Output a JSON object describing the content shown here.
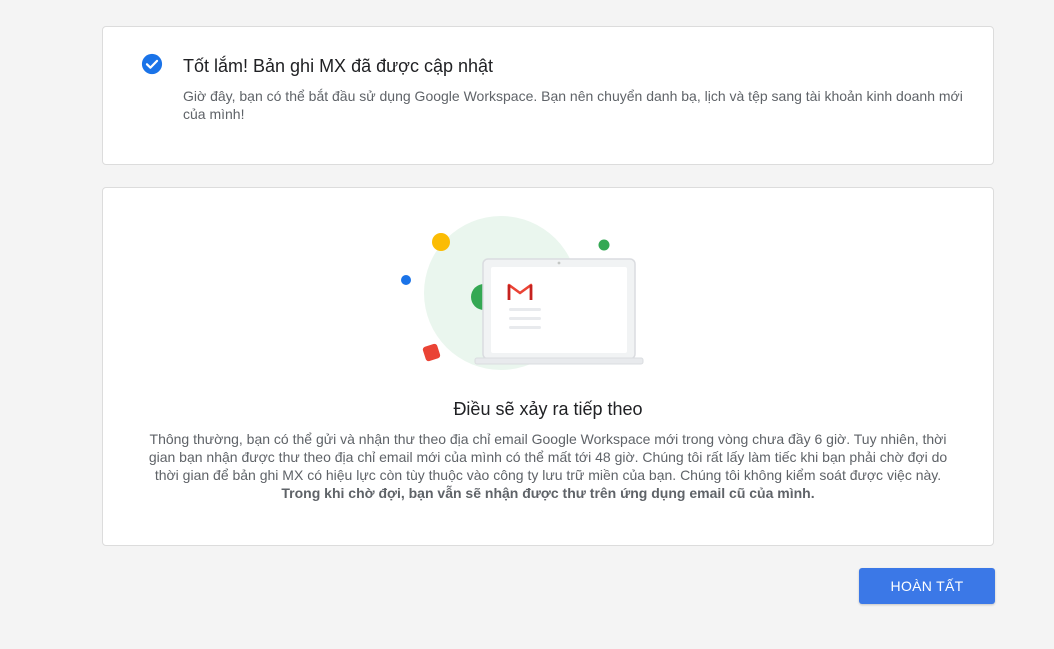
{
  "success_card": {
    "icon": "check-circle-icon",
    "title": "Tốt lắm! Bản ghi MX đã được cập nhật",
    "description": "Giờ đây, bạn có thể bắt đầu sử dụng Google Workspace. Bạn nên chuyển danh bạ, lịch và tệp sang tài khoản kinh doanh mới của mình!"
  },
  "next_card": {
    "illustration": "gmail-laptop-illustration",
    "title": "Điều sẽ xảy ra tiếp theo",
    "body": "Thông thường, bạn có thể gửi và nhận thư theo địa chỉ email Google Workspace mới trong vòng chưa đầy 6 giờ. Tuy nhiên, thời gian bạn nhận được thư theo địa chỉ email mới của mình có thể mất tới 48 giờ. Chúng tôi rất lấy làm tiếc khi bạn phải chờ đợi do thời gian để bản ghi MX có hiệu lực còn tùy thuộc vào công ty lưu trữ miền của bạn. Chúng tôi không kiểm soát được việc này.",
    "body_bold": "Trong khi chờ đợi, bạn vẫn sẽ nhận được thư trên ứng dụng email cũ của mình."
  },
  "actions": {
    "finish_label": "HOÀN TẤT"
  },
  "colors": {
    "accent": "#3b78e7",
    "check": "#1a73e8",
    "background": "#f4f4f4"
  }
}
